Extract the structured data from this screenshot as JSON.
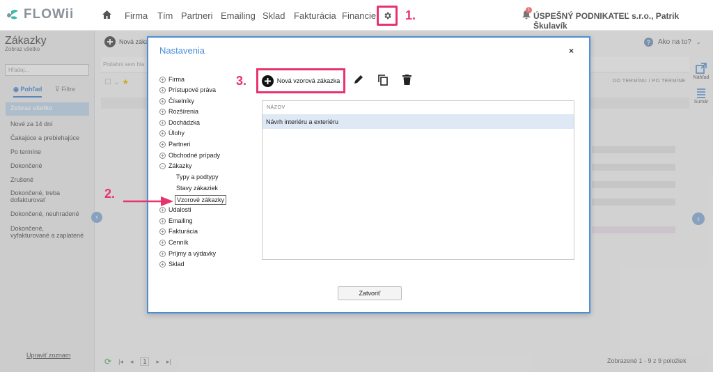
{
  "app": {
    "logo": "FLOWii"
  },
  "nav": {
    "items": [
      "Firma",
      "Tím",
      "Partneri",
      "Emailing",
      "Sklad",
      "Fakturácia",
      "Financie"
    ],
    "company": "ÚSPEŠNÝ PODNIKATEĽ s.r.o., Patrik Škulavík",
    "notif_count": "1"
  },
  "steps": {
    "one": "1.",
    "two": "2.",
    "three": "3."
  },
  "sidebar": {
    "title": "Zákazky",
    "subtitle": "Zobraz všetko",
    "search_placeholder": "Hľadaj...",
    "tab_view": "Pohľad",
    "tab_filter": "Filtre",
    "items": [
      "Zobraz všetko",
      "Nové za 14 dní",
      "Čakajúce a prebiehajúce",
      "Po termíne",
      "Dokončené",
      "Zrušené",
      "Dokončené, treba dofakturovať",
      "Dokončené, neuhradené",
      "Dokončené, vyfakturované a zaplatené"
    ],
    "edit_link": "Upraviť zoznam"
  },
  "content": {
    "new_order": "Nová záka",
    "help": "Ako na to?",
    "col_term": "DO TERMÍNU / PO TERMÍNE",
    "pager_page": "1",
    "shown": "Zobrazené 1 - 9 z 9 položiek",
    "right_preview": "Náhľad",
    "right_summary": "Sumár",
    "search_placeholder": "Potiahni sem hla"
  },
  "modal": {
    "title": "Nastavenia",
    "close": "×",
    "tree": [
      "Firma",
      "Prístupové práva",
      "Číselníky",
      "Rozšírenia",
      "Dochádzka",
      "Úlohy",
      "Partneri",
      "Obchodné prípady",
      "Zákazky"
    ],
    "tree_sub": [
      "Typy a podtypy",
      "Stavy zákaziek",
      "Vzorové zákazky"
    ],
    "tree_after": [
      "Udalosti",
      "Emailing",
      "Fakturácia",
      "Cenník",
      "Príjmy a výdavky",
      "Sklad"
    ],
    "new_template": "Nová vzorová zákazka",
    "table_header": "NÁZOV",
    "table_rows": [
      "Návrh interiéru a exteriéru"
    ],
    "close_button": "Zatvoriť"
  },
  "colors": {
    "accent": "#e8336d",
    "brand": "#3bb9b0",
    "modal_border": "#4d8ed8",
    "row_selected": "#dfe9f5"
  }
}
